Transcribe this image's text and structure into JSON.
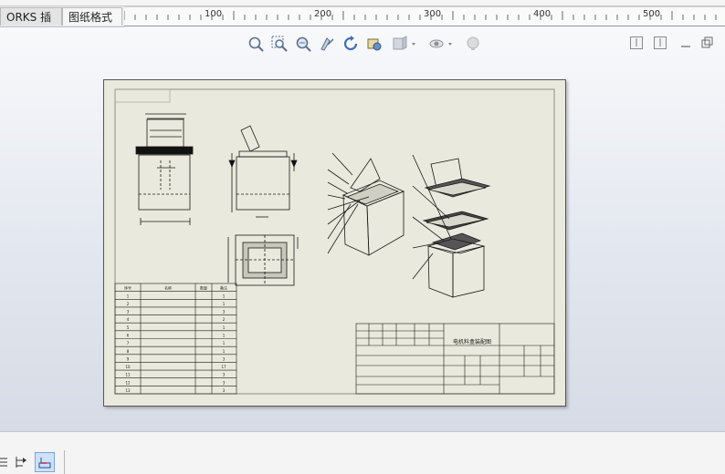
{
  "tabs": [
    {
      "label": "ORKS 插件"
    },
    {
      "label": "图纸格式"
    }
  ],
  "ruler": {
    "labels": [
      "100",
      "200",
      "300",
      "400",
      "500"
    ]
  },
  "view_toolbar": {
    "icons": [
      "zoom-to-fit-icon",
      "zoom-area-icon",
      "zoom-in-out-icon",
      "pan-icon",
      "rotate-icon",
      "previous-view-icon",
      "display-style-icon",
      "hide-show-icon",
      "lighting-icon"
    ]
  },
  "drawing": {
    "bom": {
      "headers": [
        "序号",
        "名称",
        "数量",
        "备注"
      ],
      "rows": [
        [
          "1",
          "",
          "1"
        ],
        [
          "2",
          "",
          "1"
        ],
        [
          "3",
          "",
          "3"
        ],
        [
          "4",
          "",
          "2"
        ],
        [
          "5",
          "",
          "1"
        ],
        [
          "6",
          "",
          "1"
        ],
        [
          "7",
          "",
          "1"
        ],
        [
          "8",
          "",
          "1"
        ],
        [
          "9",
          "",
          "3"
        ],
        [
          "10",
          "",
          "17"
        ],
        [
          "11",
          "",
          "3"
        ],
        [
          "12",
          "",
          "3"
        ],
        [
          "13",
          "",
          "3"
        ]
      ]
    },
    "title_block": {
      "name": "电机料盒装配图"
    }
  },
  "colors": {
    "sheet": "#e9e9dd",
    "line": "#1b1b1b",
    "viewport_top": "#f8f9fb",
    "viewport_bottom": "#d6dbe5"
  }
}
